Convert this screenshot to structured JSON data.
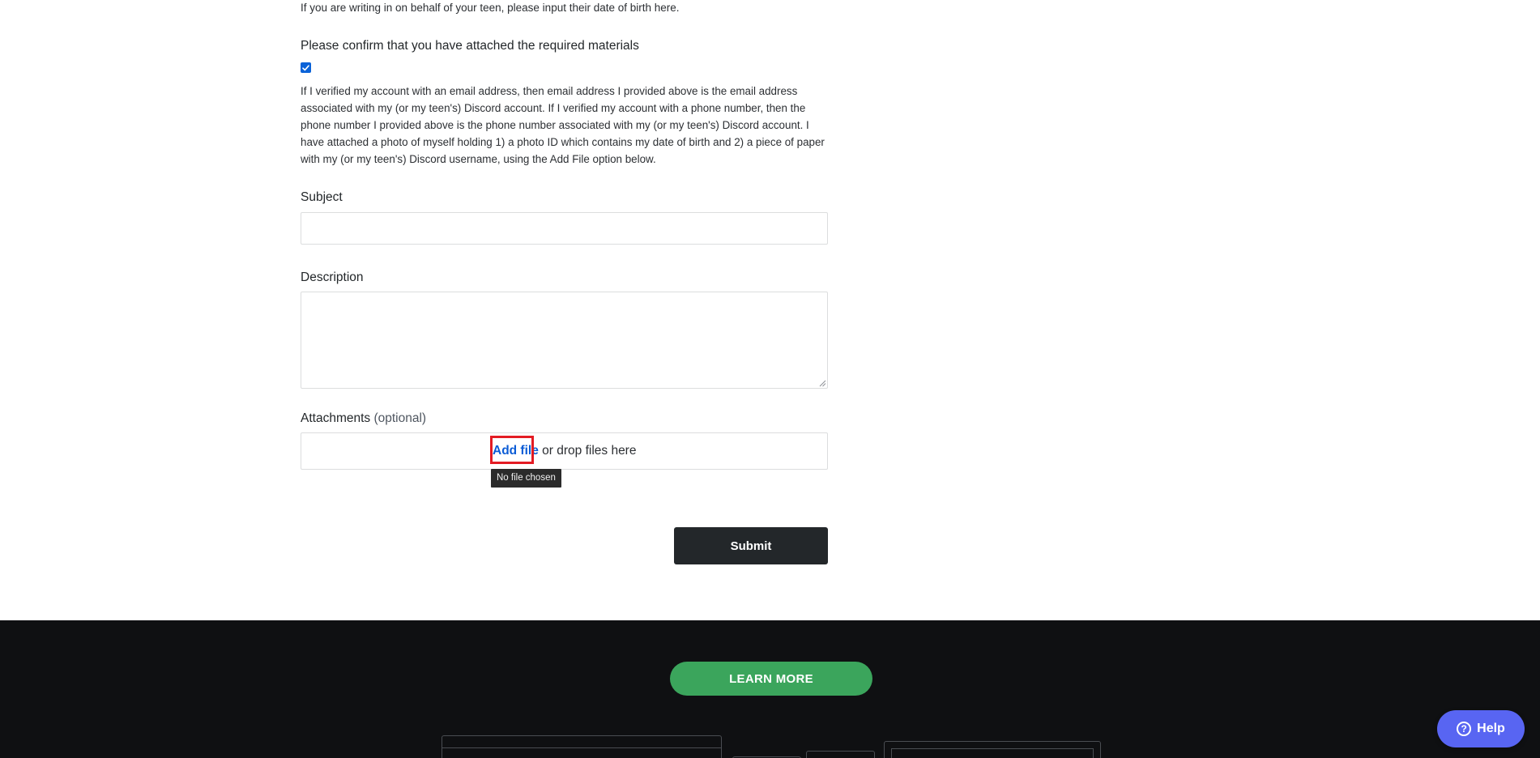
{
  "form": {
    "dob_hint": "If you are writing in on behalf of your teen, please input their date of birth here.",
    "confirm": {
      "label": "Please confirm that you have attached the required materials",
      "checked": true,
      "text": "If I verified my account with an email address, then email address I provided above is the email address associated with my (or my teen's) Discord account. If I verified my account with a phone number, then the phone number I provided above is the phone number associated with my (or my teen's) Discord account. I have attached a photo of myself holding 1) a photo ID which contains my date of birth and 2) a piece of paper with my (or my teen's) Discord username, using the Add File option below."
    },
    "subject": {
      "label": "Subject",
      "value": ""
    },
    "description": {
      "label": "Description",
      "value": ""
    },
    "attachments": {
      "label": "Attachments",
      "optional": "(optional)",
      "add_file": "Add file",
      "drop_text": "or drop files here",
      "tooltip": "No file chosen"
    },
    "submit_label": "Submit"
  },
  "footer": {
    "learn_more": "LEARN MORE"
  },
  "help": {
    "label": "Help",
    "icon": "?"
  },
  "colors": {
    "footer_bg": "#0f1012",
    "learn_more_bg": "#3ba55c",
    "help_bg": "#5865f2",
    "submit_bg": "#23272a",
    "link": "#0b5cd6",
    "highlight": "#e31b23"
  }
}
